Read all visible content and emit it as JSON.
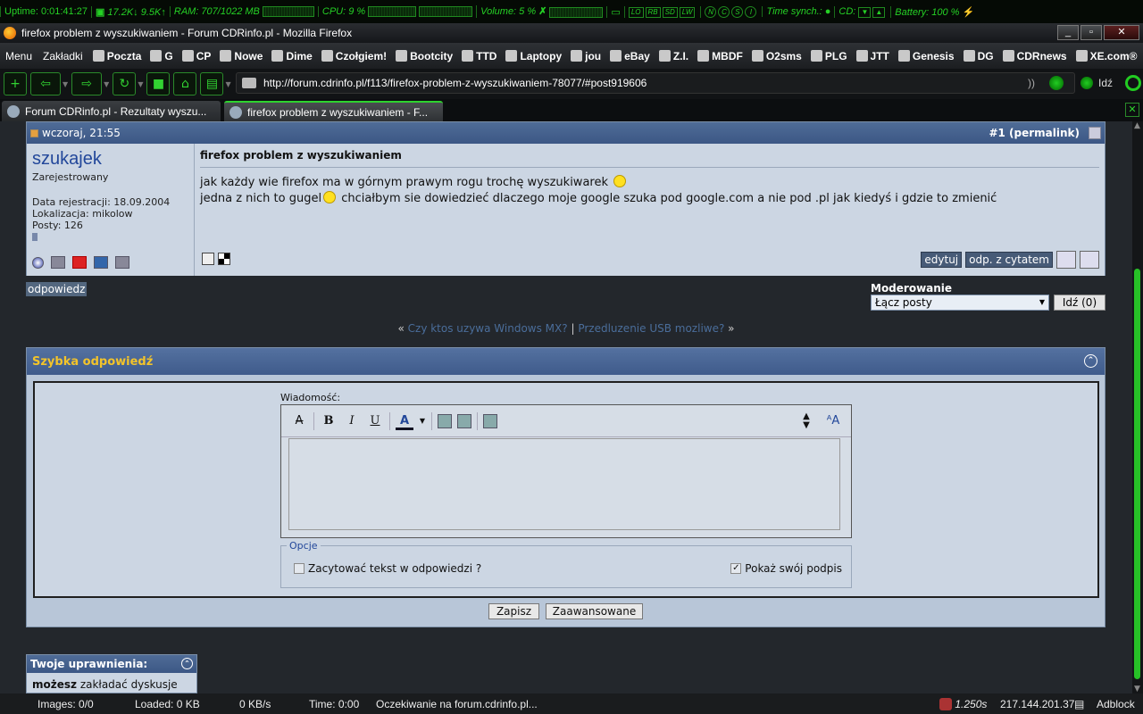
{
  "sysbar": {
    "uptime": "Uptime: 0:01:41:27",
    "down": "17.2K",
    "up": "9.5K",
    "ram": "RAM: 707/1022 MB",
    "cpu": "CPU: 9 %",
    "volume": "Volume: 5 %",
    "mini_labels": [
      "LO",
      "RB",
      "SD",
      "LW"
    ],
    "circ_labels": [
      "N",
      "C",
      "S",
      "I"
    ],
    "time_synch": "Time synch.:",
    "cd": "CD:",
    "battery": "Battery: 100 %",
    "accent": "#25d025"
  },
  "window": {
    "title": "firefox problem z wyszukiwaniem - Forum CDRinfo.pl - Mozilla Firefox",
    "min": "_",
    "max": "▫",
    "close": "✕"
  },
  "bookmarks": {
    "menu": [
      "Menu",
      "Zakładki"
    ],
    "items": [
      "Poczta",
      "G",
      "CP",
      "Nowe",
      "Dime",
      "Czołgiem!",
      "Bootcity",
      "TTD",
      "Laptopy",
      "jou",
      "eBay",
      "Z.I.",
      "MBDF",
      "O2sms",
      "PLG",
      "JTT",
      "Genesis",
      "DG",
      "CDRnews",
      "XE.com®"
    ],
    "more": "►"
  },
  "nav": {
    "url": "http://forum.cdrinfo.pl/f113/firefox-problem-z-wyszukiwaniem-78077/#post919606",
    "go": "Idź",
    "rss_icon": "rss-icon"
  },
  "tabs": [
    {
      "title": "Forum CDRinfo.pl - Rezultaty wyszu..."
    },
    {
      "title": "firefox problem z wyszukiwaniem - F..."
    }
  ],
  "post": {
    "date": "wczoraj, 21:55",
    "number": "#1 (permalink)",
    "username": "szukajek",
    "usertitle": "Zarejestrowany",
    "reg": "Data rejestracji: 18.09.2004",
    "loc": "Lokalizacja: mikolow",
    "posts": "Posty: 126",
    "title": "firefox problem z wyszukiwaniem",
    "line1": "jak każdy wie firefox ma w górnym prawym rogu trochę wyszukiwarek",
    "line2a": "jedna z nich to gugel",
    "line2b": " chciałbym sie dowiedzieć dlaczego moje google szuka pod google.com a nie pod .pl jak kiedyś i gdzie to zmienić",
    "edit_btn": "edytuj",
    "quote_btn": "odp. z cytatem"
  },
  "actions": {
    "reply": "odpowiedz",
    "mod_label": "Moderowanie",
    "mod_select": "Łącz posty",
    "mod_go": "Idź (0)"
  },
  "threadnav": {
    "open": "«",
    "prev": "Czy ktos uzywa Windows MX?",
    "sep": "|",
    "next": "Przedluzenie USB mozliwe?",
    "close": "»"
  },
  "quickreply": {
    "title": "Szybka odpowiedź",
    "message_label": "Wiadomość:",
    "options_legend": "Opcje",
    "quote_option": "Zacytować tekst w odpowiedzi ?",
    "quote_checked": false,
    "signature_option": "Pokaż swój podpis",
    "signature_checked": true,
    "save": "Zapisz",
    "advanced": "Zaawansowane"
  },
  "permissions": {
    "title": "Twoje uprawnienia:",
    "strong": "możesz",
    "text": " zakładać dyskusje"
  },
  "status": {
    "images": "Images: 0/0",
    "loaded": "Loaded: 0 KB",
    "speed": "0 KB/s",
    "time": "Time: 0:00",
    "message": "Oczekiwanie na forum.cdrinfo.pl...",
    "latency": "1.250s",
    "ip": "217.144.201.37",
    "adblock": "Adblock"
  }
}
